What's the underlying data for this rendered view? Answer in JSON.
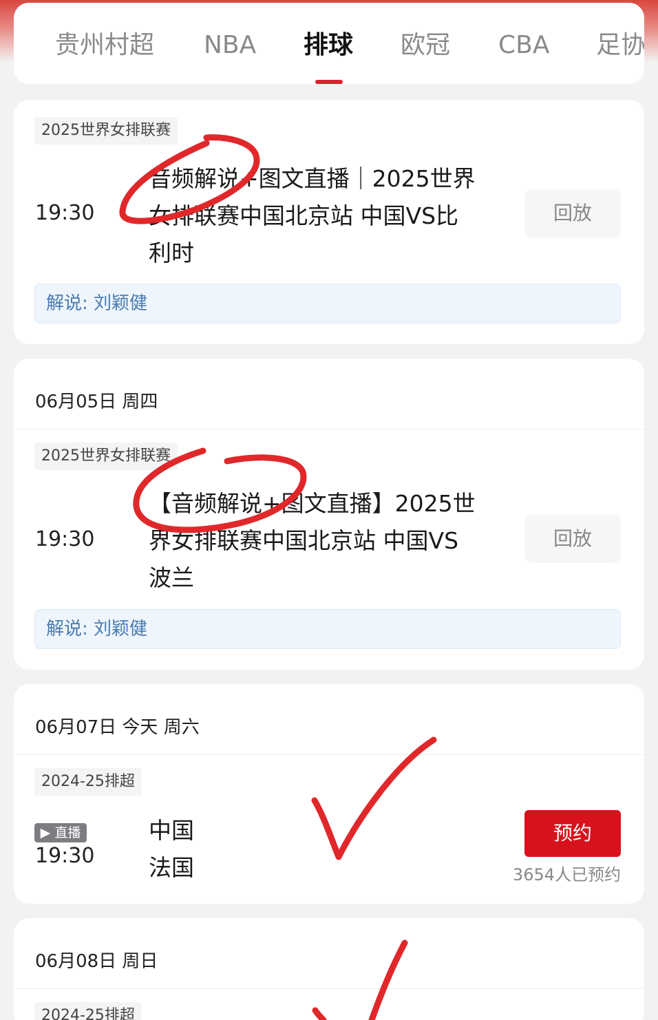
{
  "tabs": [
    {
      "label": "贵州村超"
    },
    {
      "label": "NBA"
    },
    {
      "label": "排球"
    },
    {
      "label": "欧冠"
    },
    {
      "label": "CBA"
    },
    {
      "label": "足协"
    }
  ],
  "active_tab": "排球",
  "colors": {
    "accent": "#d9232d",
    "reserve_button": "#d7121d",
    "commentator_text": "#4a7bb0",
    "annotation_ink": "#e0282a"
  },
  "card1": {
    "league": "2025世界女排联赛",
    "time": "19:30",
    "title": "音频解说+图文直播｜2025世界女排联赛中国北京站 中国VS比利时",
    "action": "回放",
    "commentator": "解说: 刘颖健"
  },
  "card2": {
    "date": "06月05日 周四",
    "league": "2025世界女排联赛",
    "time": "19:30",
    "title": "【音频解说+图文直播】2025世界女排联赛中国北京站 中国VS波兰",
    "action": "回放",
    "commentator": "解说: 刘颖健"
  },
  "card3": {
    "date": "06月07日 今天 周六",
    "league": "2024-25排超",
    "badge": "▶ 直播",
    "time": "19:30",
    "team_home": "中国",
    "team_away": "法国",
    "action": "预约",
    "reserve_count": "3654人已预约"
  },
  "card4": {
    "date": "06月08日 周日",
    "league": "2024-25排超"
  }
}
